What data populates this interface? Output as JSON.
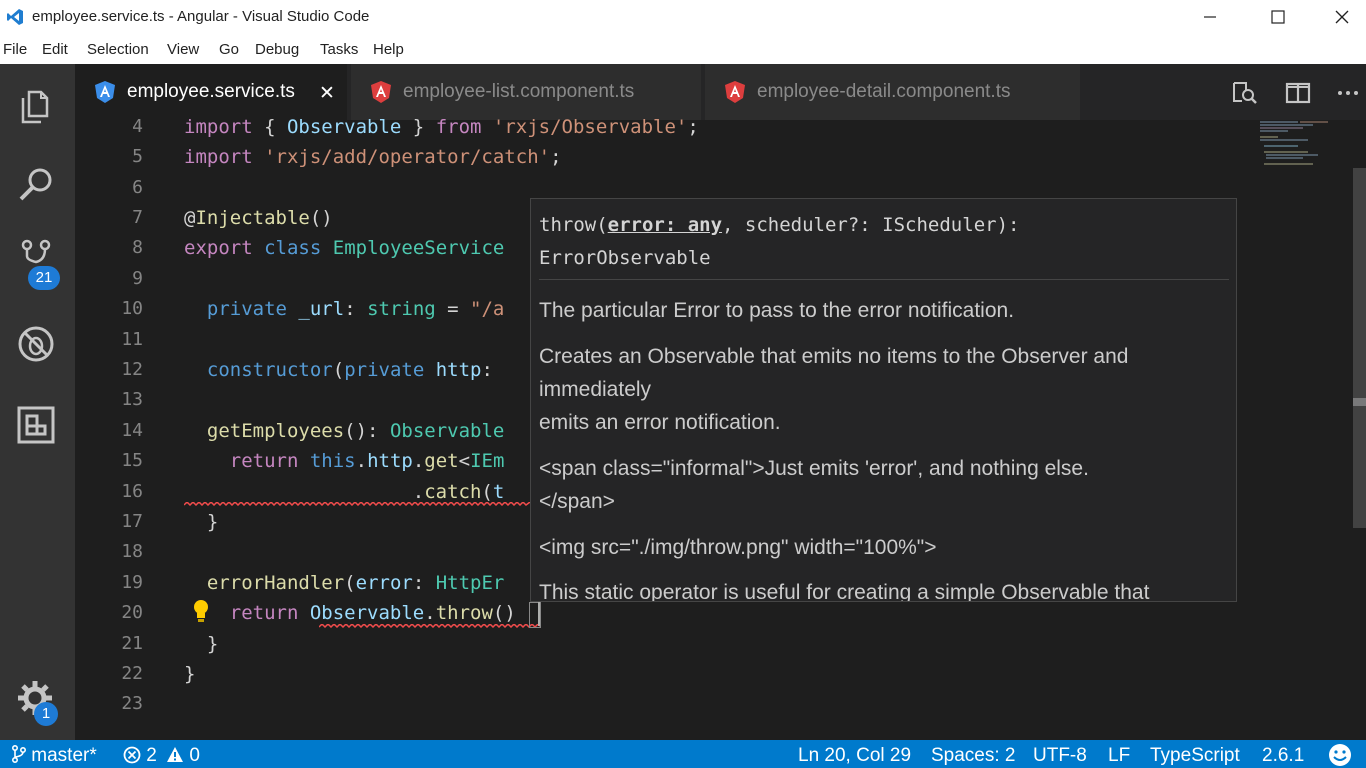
{
  "window": {
    "title": "employee.service.ts - Angular - Visual Studio Code",
    "controls": [
      "minimize",
      "maximize",
      "close"
    ]
  },
  "menu": [
    "File",
    "Edit",
    "Selection",
    "View",
    "Go",
    "Debug",
    "Tasks",
    "Help"
  ],
  "activity_bar": {
    "items": [
      "explorer-icon",
      "search-icon",
      "source-control-icon",
      "debug-icon",
      "extensions-icon"
    ],
    "scm_badge": "21",
    "settings_badge": "1"
  },
  "tabs": [
    {
      "label": "employee.service.ts",
      "active": true,
      "icon": "angular-icon-blue",
      "close": "✕"
    },
    {
      "label": "employee-list.component.ts",
      "active": false,
      "icon": "angular-icon-red"
    },
    {
      "label": "employee-detail.component.ts",
      "active": false,
      "icon": "angular-icon-red"
    }
  ],
  "editor": {
    "line_numbers": [
      "4",
      "5",
      "6",
      "7",
      "8",
      "9",
      "10",
      "11",
      "12",
      "13",
      "14",
      "15",
      "16",
      "17",
      "18",
      "19",
      "20",
      "21",
      "22",
      "23"
    ]
  },
  "hover": {
    "signature": {
      "prefix": "throw(",
      "param": "error: any",
      "rest": ", scheduler?: IScheduler):",
      "return_type": "ErrorObservable"
    },
    "paragraphs": [
      "The particular Error to pass to the error notification.",
      "Creates an Observable that emits no items to the Observer and",
      "immediately",
      "emits an error notification.",
      "<span class=\"informal\">Just emits 'error', and nothing else.",
      "</span>",
      "<img src=\"./img/throw.png\" width=\"100%\">",
      "This static operator is useful for creating a simple Observable that"
    ]
  },
  "status": {
    "branch": "master*",
    "errors": "2",
    "warnings": "0",
    "position": "Ln 20, Col 29",
    "spaces": "Spaces: 2",
    "encoding": "UTF-8",
    "eol": "LF",
    "language": "TypeScript",
    "version": "2.6.1"
  },
  "colors": {
    "status_bar": "#007acc",
    "activity_bar": "#333333",
    "editor_bg": "#1e1e1e",
    "badge": "#1e7bd6"
  }
}
